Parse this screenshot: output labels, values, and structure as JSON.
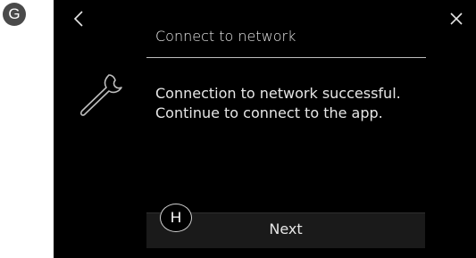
{
  "markers": {
    "g": "G",
    "h": "H"
  },
  "header": {
    "back_icon": "chevron-left-icon",
    "title": "Connect to network",
    "close_icon": "close-icon"
  },
  "content": {
    "icon": "wrench-icon",
    "message_line1": "Connection to network successful.",
    "message_line2": "Continue to connect to the app."
  },
  "footer": {
    "next_label": "Next"
  },
  "colors": {
    "screen_background": "#000000",
    "text": "#e6e6e6",
    "button_background": "#1a1a1a",
    "marker_background": "#4a4a4a"
  }
}
